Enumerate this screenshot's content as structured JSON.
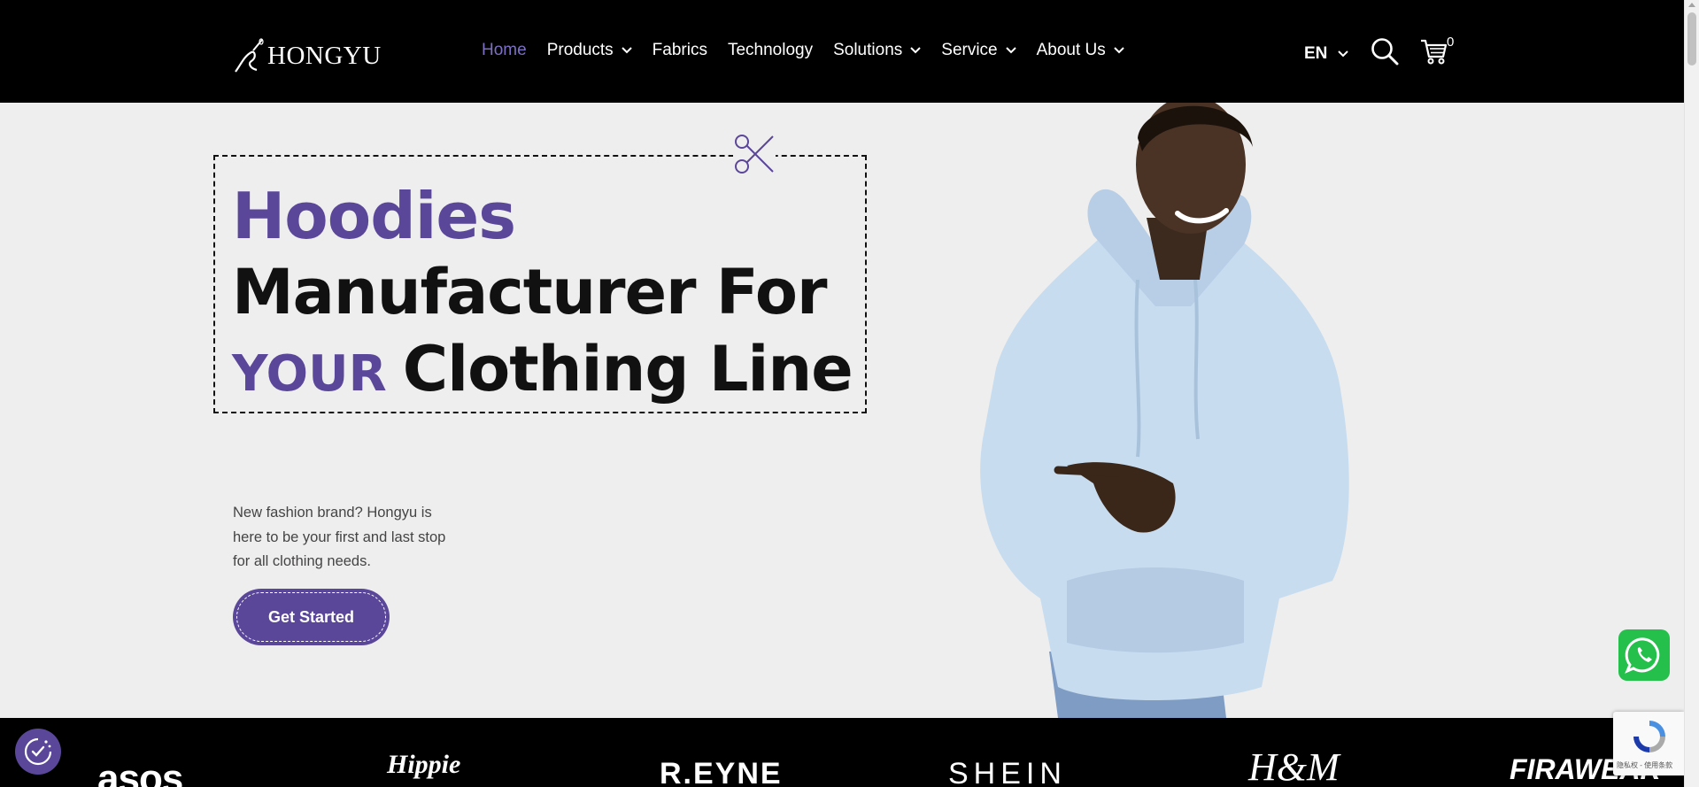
{
  "header": {
    "logo_text": "HONGYU",
    "nav": [
      {
        "label": "Home",
        "active": true,
        "dropdown": false
      },
      {
        "label": "Products",
        "active": false,
        "dropdown": true
      },
      {
        "label": "Fabrics",
        "active": false,
        "dropdown": false
      },
      {
        "label": "Technology",
        "active": false,
        "dropdown": false
      },
      {
        "label": "Solutions",
        "active": false,
        "dropdown": true
      },
      {
        "label": "Service",
        "active": false,
        "dropdown": true
      },
      {
        "label": "About Us",
        "active": false,
        "dropdown": true
      }
    ],
    "language": "EN",
    "cart_count": "0",
    "icons": {
      "search": "search-icon",
      "cart": "cart-icon",
      "language": "chevron-down-icon"
    }
  },
  "hero": {
    "line1": "Hoodies",
    "line2": "Manufacturer For",
    "line3_accent": "YOUR",
    "line3_rest": "Clothing Line",
    "description": "New fashion brand? Hongyu is here to be your first and last stop for all clothing needs.",
    "cta_label": "Get Started",
    "decor_icon": "scissors-icon"
  },
  "brands": [
    "asos",
    "Hippie",
    "R.EYNE",
    "SHEIN",
    "H&M",
    "FIRAWEAR"
  ],
  "widgets": {
    "recaptcha_text": "隐私权 - 使用条款",
    "cookie_icon": "cookie-consent-icon",
    "whatsapp_icon": "whatsapp-icon"
  },
  "colors": {
    "accent": "#5b4799",
    "nav_active": "#7d6fc4",
    "header_bg": "#000000",
    "page_bg": "#efeeee",
    "whatsapp": "#25c04c"
  }
}
